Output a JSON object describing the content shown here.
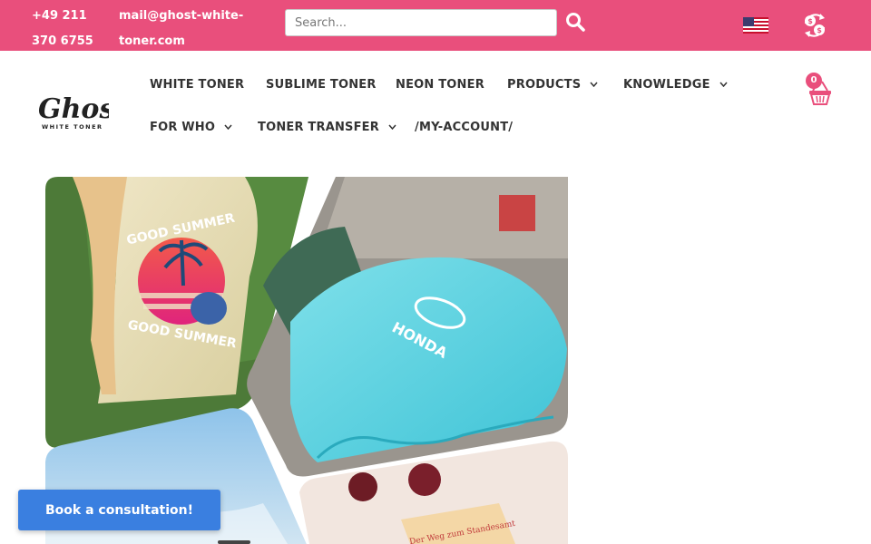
{
  "topbar": {
    "phone": "+49 211 370 6755",
    "email": "mail@ghost-white-toner.com",
    "search_placeholder": "Search...",
    "search_icon": "search-icon",
    "flag_icon": "us-flag-icon",
    "currency_icon": "currency-switch-icon"
  },
  "brand": {
    "logo_text": "Ghost",
    "logo_sub": "WHITE TONER"
  },
  "nav": {
    "items": [
      {
        "label": "WHITE TONER"
      },
      {
        "label": "SUBLIME TONER"
      },
      {
        "label": "NEON TONER"
      },
      {
        "label": "PRODUCTS"
      },
      {
        "label": "KNOWLEDGE"
      },
      {
        "label": "FOR WHO"
      },
      {
        "label": "TONER TRANSFER"
      },
      {
        "label": "/MY-ACCOUNT/"
      }
    ]
  },
  "cart": {
    "count": "0",
    "icon": "basket-icon"
  },
  "hero": {
    "tshirt_text_top": "GOOD SUMMER",
    "tshirt_text_bottom": "GOOD SUMMER",
    "car_cover_text": "HONDA",
    "card_text": "Der Weg zum Standesamt"
  },
  "consult": {
    "label": "Book a consultation!"
  },
  "colors": {
    "brand_pink": "#e94f7c",
    "button_blue": "#3a7fe0",
    "nav_text": "#333333"
  }
}
